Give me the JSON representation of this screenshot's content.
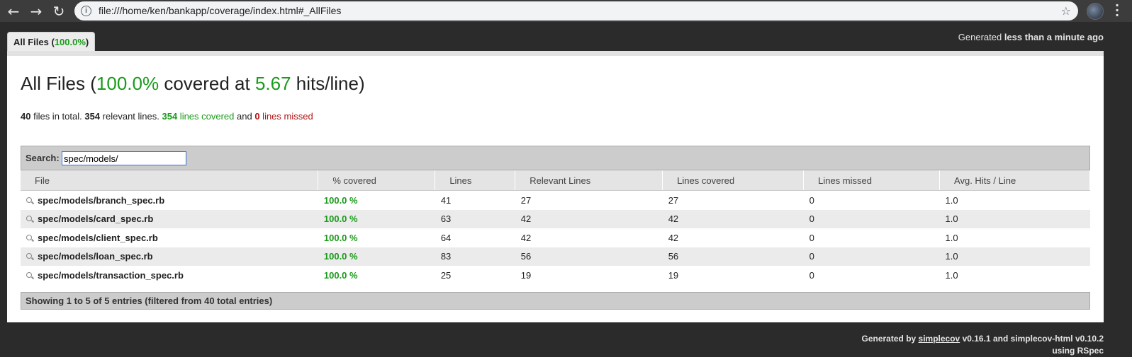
{
  "browser": {
    "url": "file:///home/ken/bankapp/coverage/index.html#_AllFiles"
  },
  "tab": {
    "label": "All Files",
    "percent": "100.0%"
  },
  "generated_top": {
    "prefix": "Generated",
    "time": "less than a minute ago"
  },
  "title": {
    "prefix": "All Files (",
    "covered_percent": "100.0%",
    "middle": " covered at ",
    "hits": "5.67",
    "suffix": " hits/line)"
  },
  "stats": {
    "files": "40",
    "files_text": " files in total. ",
    "relevant": "354",
    "relevant_text": " relevant lines. ",
    "covered": "354",
    "covered_text": " lines covered",
    "and_text": " and ",
    "missed": "0",
    "missed_text": " lines missed"
  },
  "search": {
    "label": "Search:",
    "value": "spec/models/"
  },
  "table": {
    "headers": [
      "File",
      "% covered",
      "Lines",
      "Relevant Lines",
      "Lines covered",
      "Lines missed",
      "Avg. Hits / Line"
    ],
    "rows": [
      {
        "file": "spec/models/branch_spec.rb",
        "pct": "100.0 %",
        "lines": "41",
        "relevant": "27",
        "covered": "27",
        "missed": "0",
        "avg": "1.0"
      },
      {
        "file": "spec/models/card_spec.rb",
        "pct": "100.0 %",
        "lines": "63",
        "relevant": "42",
        "covered": "42",
        "missed": "0",
        "avg": "1.0"
      },
      {
        "file": "spec/models/client_spec.rb",
        "pct": "100.0 %",
        "lines": "64",
        "relevant": "42",
        "covered": "42",
        "missed": "0",
        "avg": "1.0"
      },
      {
        "file": "spec/models/loan_spec.rb",
        "pct": "100.0 %",
        "lines": "83",
        "relevant": "56",
        "covered": "56",
        "missed": "0",
        "avg": "1.0"
      },
      {
        "file": "spec/models/transaction_spec.rb",
        "pct": "100.0 %",
        "lines": "25",
        "relevant": "19",
        "covered": "19",
        "missed": "0",
        "avg": "1.0"
      }
    ]
  },
  "showing": "Showing 1 to 5 of 5 entries (filtered from 40 total entries)",
  "footer": {
    "generated_by": "Generated by ",
    "link": "simplecov",
    "versions": " v0.16.1 and simplecov-html v0.10.2",
    "using": "using RSpec"
  },
  "colors": {
    "green": "#1a9b1a",
    "red": "#b31313",
    "background": "#2b2b2b"
  }
}
